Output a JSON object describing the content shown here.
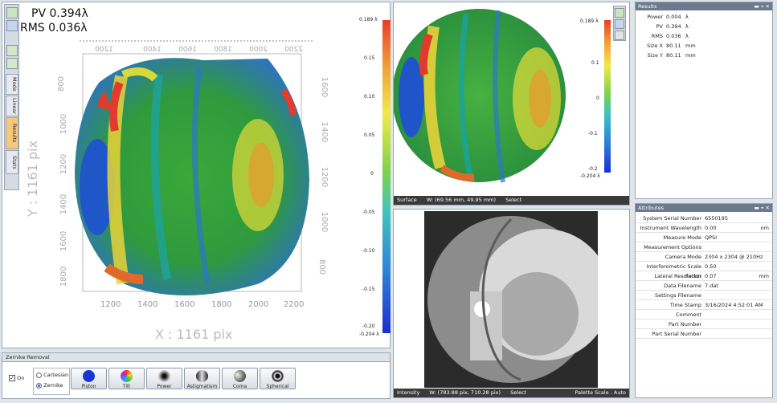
{
  "left_plot": {
    "pv": "PV 0.394λ",
    "rms": "RMS 0.036λ",
    "x_label": "X : 1161 pix",
    "y_label": "Y : 1161 pix",
    "top_ticks": [
      "2200",
      "2000",
      "1800",
      "1600",
      "1400",
      "1200"
    ],
    "bottom_ticks": [
      "1200",
      "1400",
      "1600",
      "1800",
      "2000",
      "2200"
    ],
    "left_ticks": [
      "800",
      "1000",
      "1200",
      "1400",
      "1600",
      "1800"
    ],
    "right_ticks": [
      "1600",
      "1400",
      "1200",
      "1000",
      "800"
    ],
    "side_tabs": [
      "Mode",
      "Linear",
      "Results",
      "Stats"
    ]
  },
  "color_scale_left": {
    "ticks": [
      "0.189 λ",
      "0.15",
      "0.10",
      "0.05",
      "0",
      "-0.05",
      "-0.10",
      "-0.15",
      "-0.20",
      "-0.204 λ"
    ]
  },
  "surface_panel": {
    "color_scale_ticks": [
      "0.189 λ",
      "0.1",
      "0",
      "-0.1",
      "-0.2",
      "-0.204 λ"
    ],
    "status": {
      "mode": "Surface",
      "coords": "W: (69.56 mm, 49.95 mm)",
      "action": "Select"
    }
  },
  "intensity_panel": {
    "status": {
      "mode": "Intensity",
      "coords": "W: (783.88 pix, 710.28 pix)",
      "action": "Select",
      "palette": "Palette Scale : Auto"
    }
  },
  "results": {
    "title": "Results",
    "rows": [
      {
        "label": "Power",
        "value": "0.004",
        "unit": "λ"
      },
      {
        "label": "PV",
        "value": "0.394",
        "unit": "λ"
      },
      {
        "label": "RMS",
        "value": "0.036",
        "unit": "λ"
      },
      {
        "label": "Size X",
        "value": "80.11",
        "unit": "mm"
      },
      {
        "label": "Size Y",
        "value": "80.11",
        "unit": "mm"
      }
    ]
  },
  "attributes": {
    "title": "Attributes",
    "rows": [
      {
        "label": "System Serial Number",
        "value": "6550195",
        "unit": ""
      },
      {
        "label": "Instrument Wavelength",
        "value": "0.00",
        "unit": "nm"
      },
      {
        "label": "Measure Mode",
        "value": "QPSI",
        "unit": ""
      },
      {
        "label": "Measurement Options",
        "value": "",
        "unit": ""
      },
      {
        "label": "Camera Mode",
        "value": "2304 x 2304 @ 210Hz",
        "unit": ""
      },
      {
        "label": "Interferometric Scale Factor",
        "value": "0.50",
        "unit": ""
      },
      {
        "label": "Lateral Resolution",
        "value": "0.07",
        "unit": "mm"
      },
      {
        "label": "Data Filename",
        "value": "7.dat",
        "unit": ""
      },
      {
        "label": "Settings Filename",
        "value": "",
        "unit": ""
      },
      {
        "label": "Time Stamp",
        "value": "3/16/2024 4:52:01 AM",
        "unit": ""
      },
      {
        "label": "Comment",
        "value": "",
        "unit": ""
      },
      {
        "label": "Part Number",
        "value": "",
        "unit": ""
      },
      {
        "label": "Part Serial Number",
        "value": "",
        "unit": ""
      }
    ]
  },
  "zernike": {
    "title": "Zernike Removal",
    "on_label": "On",
    "on_checked": true,
    "options": [
      "Cartesian",
      "Zernike"
    ],
    "selected_option": "Zernike",
    "buttons": [
      "Piston",
      "Tilt",
      "Power",
      "Astigmatism",
      "Coma",
      "Spherical"
    ]
  },
  "colors": {
    "accent_tab": "#f7c77e",
    "panel_title": "#6c7a8e",
    "status_bar": "#3a3a3a"
  }
}
